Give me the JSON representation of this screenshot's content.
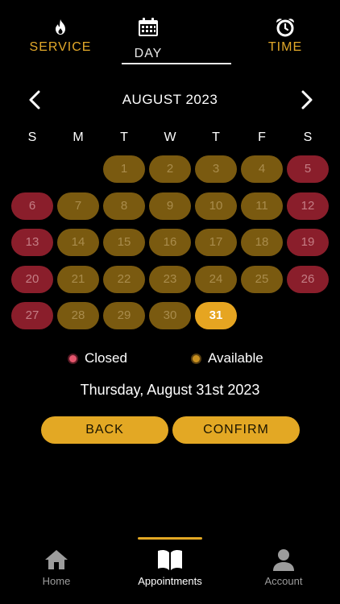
{
  "tabs": {
    "service": {
      "label": "SERVICE",
      "icon": "flame-icon"
    },
    "day": {
      "label": "DAY",
      "icon": "calendar-icon"
    },
    "time": {
      "label": "TIME",
      "icon": "alarm-clock-icon"
    }
  },
  "calendar": {
    "month_title": "AUGUST 2023",
    "prev_icon": "chevron-left-icon",
    "next_icon": "chevron-right-icon",
    "weekdays": [
      "S",
      "M",
      "T",
      "W",
      "T",
      "F",
      "S"
    ],
    "first_weekday_index": 2,
    "days": [
      {
        "n": "1",
        "status": "available"
      },
      {
        "n": "2",
        "status": "available"
      },
      {
        "n": "3",
        "status": "available"
      },
      {
        "n": "4",
        "status": "available"
      },
      {
        "n": "5",
        "status": "closed"
      },
      {
        "n": "6",
        "status": "closed"
      },
      {
        "n": "7",
        "status": "available"
      },
      {
        "n": "8",
        "status": "available"
      },
      {
        "n": "9",
        "status": "available"
      },
      {
        "n": "10",
        "status": "available"
      },
      {
        "n": "11",
        "status": "available"
      },
      {
        "n": "12",
        "status": "closed"
      },
      {
        "n": "13",
        "status": "closed"
      },
      {
        "n": "14",
        "status": "available"
      },
      {
        "n": "15",
        "status": "available"
      },
      {
        "n": "16",
        "status": "available"
      },
      {
        "n": "17",
        "status": "available"
      },
      {
        "n": "18",
        "status": "available"
      },
      {
        "n": "19",
        "status": "closed"
      },
      {
        "n": "20",
        "status": "closed"
      },
      {
        "n": "21",
        "status": "available"
      },
      {
        "n": "22",
        "status": "available"
      },
      {
        "n": "23",
        "status": "available"
      },
      {
        "n": "24",
        "status": "available"
      },
      {
        "n": "25",
        "status": "available"
      },
      {
        "n": "26",
        "status": "closed"
      },
      {
        "n": "27",
        "status": "closed"
      },
      {
        "n": "28",
        "status": "available"
      },
      {
        "n": "29",
        "status": "available"
      },
      {
        "n": "30",
        "status": "available"
      },
      {
        "n": "31",
        "status": "selected"
      }
    ]
  },
  "legend": {
    "closed_label": "Closed",
    "available_label": "Available"
  },
  "selected_date_text": "Thursday, August 31st 2023",
  "actions": {
    "back_label": "BACK",
    "confirm_label": "CONFIRM"
  },
  "bottom_nav": {
    "home": {
      "label": "Home",
      "icon": "house-icon"
    },
    "appointments": {
      "label": "Appointments",
      "icon": "open-book-icon"
    },
    "account": {
      "label": "Account",
      "icon": "person-icon"
    }
  },
  "colors": {
    "accent": "#e3a824",
    "closed": "#8a1e2b",
    "available": "#7a5a10",
    "selected": "#e6a521",
    "background": "#000000"
  }
}
